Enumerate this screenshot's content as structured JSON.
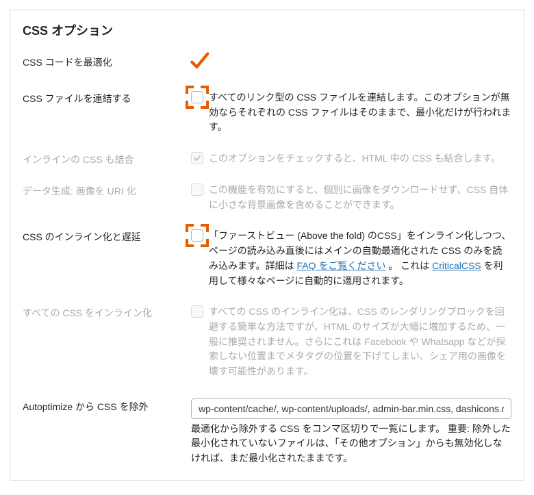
{
  "section_title": "CSS オプション",
  "rows": {
    "optimize_css": {
      "label": "CSS コードを最適化"
    },
    "combine_css": {
      "label": "CSS ファイルを連結する",
      "desc": "すべてのリンク型の CSS ファイルを連結します。このオプションが無効ならそれぞれの CSS ファイルはそのままで、最小化だけが行われます。"
    },
    "inline_css_also": {
      "label": "インラインの CSS も結合",
      "desc": "このオプションをチェックすると、HTML 中の CSS も結合します。"
    },
    "data_uri": {
      "label": "データ生成: 画像を URI 化",
      "desc": "この機能を有効にすると、個別に画像をダウンロードせず、CSS 自体に小さな背景画像を含めることができます。"
    },
    "inline_defer": {
      "label": "CSS のインライン化と遅延",
      "desc_parts": {
        "p1": "「ファーストビュー (Above the fold) のCSS」をインライン化しつつ、ページの読み込み直後にはメインの自動最適化された CSS のみを読み込みます。詳細は ",
        "link1": "FAQ をご覧ください",
        "p2": " 。 これは ",
        "link2": "CriticalCSS",
        "p3": " を利用して様々なページに自動的に適用されます。"
      }
    },
    "inline_all": {
      "label": "すべての CSS をインライン化",
      "desc": "すべての CSS のインライン化は、CSS のレンダリングブロックを回避する簡単な方法ですが、HTML のサイズが大幅に増加するため、一般に推奨されません。さらにこれは Facebook や Whatsapp などが探索しない位置までメタタグの位置を下げてしまい、シェア用の画像を壊す可能性があります。"
    },
    "exclude_css": {
      "label": "Autoptimize から CSS を除外",
      "value": "wp-content/cache/, wp-content/uploads/, admin-bar.min.css, dashicons.min.css",
      "help": "最適化から除外する CSS をコンマ区切りで一覧にします。 重要: 除外した最小化されていないファイルは、「その他オプション」からも無効化しなければ、まだ最小化されたままです。"
    }
  }
}
